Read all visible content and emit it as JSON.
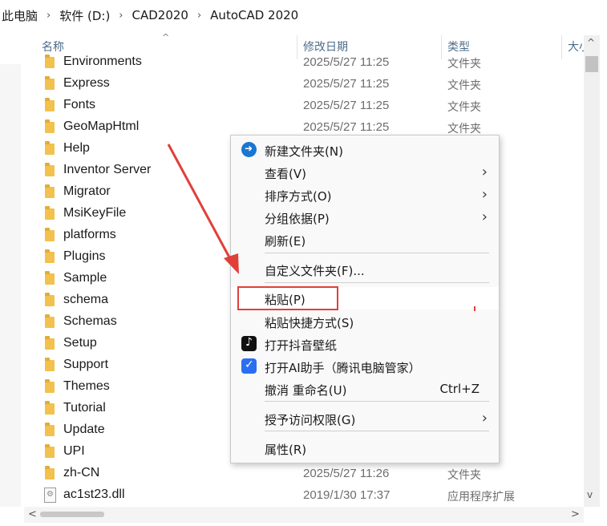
{
  "breadcrumb": [
    "此电脑",
    "软件 (D:)",
    "CAD2020",
    "AutoCAD 2020"
  ],
  "breadcrumb_separator": "›",
  "columns": {
    "name": "名称",
    "date": "修改日期",
    "type": "类型",
    "size": "大小"
  },
  "files": [
    {
      "name": "Environments",
      "date": "2025/5/27 11:25",
      "type": "文件夹",
      "kind": "folder"
    },
    {
      "name": "Express",
      "date": "2025/5/27 11:25",
      "type": "文件夹",
      "kind": "folder"
    },
    {
      "name": "Fonts",
      "date": "2025/5/27 11:25",
      "type": "文件夹",
      "kind": "folder"
    },
    {
      "name": "GeoMapHtml",
      "date": "2025/5/27 11:25",
      "type": "文件夹",
      "kind": "folder"
    },
    {
      "name": "Help",
      "date": "",
      "type": "",
      "kind": "folder"
    },
    {
      "name": "Inventor Server",
      "date": "",
      "type": "",
      "kind": "folder"
    },
    {
      "name": "Migrator",
      "date": "",
      "type": "",
      "kind": "folder"
    },
    {
      "name": "MsiKeyFile",
      "date": "",
      "type": "",
      "kind": "folder"
    },
    {
      "name": "platforms",
      "date": "",
      "type": "",
      "kind": "folder"
    },
    {
      "name": "Plugins",
      "date": "",
      "type": "",
      "kind": "folder"
    },
    {
      "name": "Sample",
      "date": "",
      "type": "",
      "kind": "folder"
    },
    {
      "name": "schema",
      "date": "",
      "type": "",
      "kind": "folder"
    },
    {
      "name": "Schemas",
      "date": "",
      "type": "",
      "kind": "folder"
    },
    {
      "name": "Setup",
      "date": "",
      "type": "",
      "kind": "folder"
    },
    {
      "name": "Support",
      "date": "",
      "type": "",
      "kind": "folder"
    },
    {
      "name": "Themes",
      "date": "",
      "type": "",
      "kind": "folder"
    },
    {
      "name": "Tutorial",
      "date": "",
      "type": "",
      "kind": "folder"
    },
    {
      "name": "Update",
      "date": "",
      "type": "",
      "kind": "folder"
    },
    {
      "name": "UPI",
      "date": "",
      "type": "",
      "kind": "folder"
    },
    {
      "name": "zh-CN",
      "date": "2025/5/27 11:26",
      "type": "文件夹",
      "kind": "folder"
    },
    {
      "name": "ac1st23.dll",
      "date": "2019/1/30 17:37",
      "type": "应用程序扩展",
      "kind": "dll"
    }
  ],
  "context_menu": {
    "items": [
      {
        "label": "新建文件夹(N)",
        "icon": "new-folder-icon",
        "submenu": false,
        "shortcut": ""
      },
      {
        "label": "查看(V)",
        "icon": "",
        "submenu": true,
        "shortcut": ""
      },
      {
        "label": "排序方式(O)",
        "icon": "",
        "submenu": true,
        "shortcut": ""
      },
      {
        "label": "分组依据(P)",
        "icon": "",
        "submenu": true,
        "shortcut": ""
      },
      {
        "label": "刷新(E)",
        "icon": "",
        "submenu": false,
        "shortcut": ""
      },
      {
        "label": "自定义文件夹(F)...",
        "icon": "",
        "submenu": false,
        "shortcut": ""
      },
      {
        "label": "粘贴(P)",
        "icon": "",
        "submenu": false,
        "shortcut": "",
        "highlighted": true
      },
      {
        "label": "粘贴快捷方式(S)",
        "icon": "",
        "submenu": false,
        "shortcut": ""
      },
      {
        "label": "打开抖音壁纸",
        "icon": "tiktok-icon",
        "submenu": false,
        "shortcut": ""
      },
      {
        "label": "打开AI助手（腾讯电脑管家）",
        "icon": "tencent-shield-icon",
        "submenu": false,
        "shortcut": ""
      },
      {
        "label": "撤消 重命名(U)",
        "icon": "",
        "submenu": false,
        "shortcut": "Ctrl+Z"
      },
      {
        "label": "授予访问权限(G)",
        "icon": "",
        "submenu": true,
        "shortcut": ""
      },
      {
        "label": "属性(R)",
        "icon": "",
        "submenu": false,
        "shortcut": ""
      }
    ]
  },
  "annotation": {
    "color": "#e0403a",
    "target": "粘贴(P)"
  },
  "icons": {
    "submenu_arrow": "chevron-right-icon",
    "sort": "sort-ascending-icon",
    "scroll_up": "chevron-up-icon",
    "scroll_down": "chevron-down-icon",
    "scroll_left": "chevron-left-icon",
    "scroll_right": "chevron-right-icon"
  }
}
